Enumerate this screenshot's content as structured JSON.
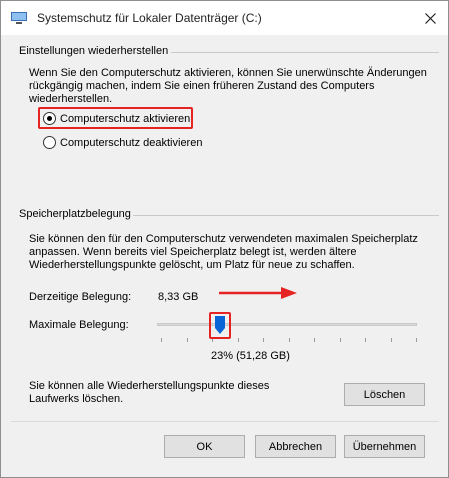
{
  "window": {
    "title": "Systemschutz für Lokaler Datenträger (C:)"
  },
  "restore": {
    "header": "Einstellungen wiederherstellen",
    "description_line1": "Wenn Sie den Computerschutz aktivieren, können Sie unerwünschte Änderungen",
    "description_line2": "rückgängig machen, indem Sie einen früheren Zustand des Computers",
    "description_line3": "wiederherstellen.",
    "option_enable": "Computerschutz aktivieren",
    "option_disable": "Computerschutz deaktivieren",
    "selected": "enable"
  },
  "usage": {
    "header": "Speicherplatzbelegung",
    "description_line1": "Sie können den für den Computerschutz verwendeten maximalen Speicherplatz",
    "description_line2": "anpassen. Wenn bereits viel Speicherplatz belegt ist, werden ältere",
    "description_line3": "Wiederherstellungspunkte gelöscht, um Platz für neue zu schaffen.",
    "current_label": "Derzeitige Belegung:",
    "current_value": "8,33 GB",
    "max_label": "Maximale Belegung:",
    "max_value": "23% (51,28 GB)",
    "max_percent": 23
  },
  "delete": {
    "text_line1": "Sie können alle Wiederherstellungspunkte dieses",
    "text_line2": "Laufwerks löschen.",
    "button": "Löschen"
  },
  "footer": {
    "ok": "OK",
    "cancel": "Abbrechen",
    "apply": "Übernehmen"
  },
  "colors": {
    "highlight": "#e52323",
    "slider_thumb": "#0a64d6"
  }
}
